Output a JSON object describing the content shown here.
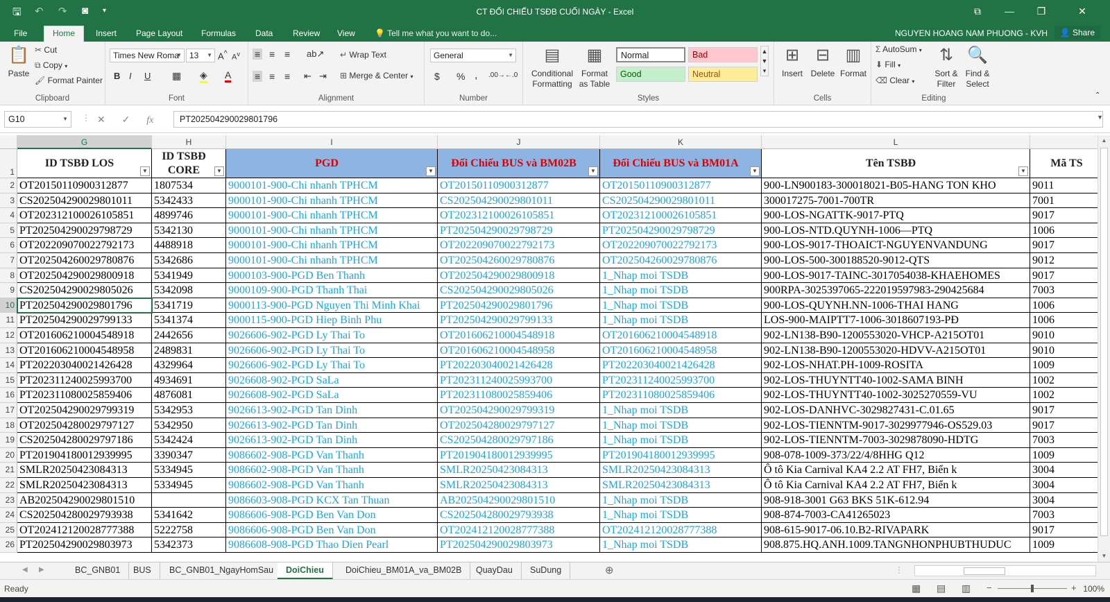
{
  "window": {
    "title": "CT ĐỐI CHIẾU TSĐB CUỐI NGÀY - Excel",
    "minimize_label": "—",
    "maximize_label": "❐",
    "close_label": "✕",
    "ribbon_display_label": "⧉"
  },
  "menu": {
    "file": "File",
    "tabs": [
      "Home",
      "Insert",
      "Page Layout",
      "Formulas",
      "Data",
      "Review",
      "View"
    ],
    "active_tab": "Home",
    "tell_me": "Tell me what you want to do...",
    "user": "NGUYEN HOANG NAM PHUONG - KVH",
    "share": "Share"
  },
  "ribbon": {
    "clipboard": {
      "label": "Clipboard",
      "paste": "Paste",
      "cut": "Cut",
      "copy": "Copy",
      "format_painter": "Format Painter"
    },
    "font": {
      "label": "Font",
      "name": "Times New Roma",
      "size": "13",
      "bold": "B",
      "italic": "I",
      "underline": "U"
    },
    "alignment": {
      "label": "Alignment",
      "wrap_text": "Wrap Text",
      "merge_center": "Merge & Center"
    },
    "number": {
      "label": "Number",
      "format": "General",
      "currency": "$",
      "percent": "%",
      "comma": ","
    },
    "styles": {
      "label": "Styles",
      "conditional": "Conditional Formatting",
      "format_as_table": "Format as Table",
      "normal": "Normal",
      "bad": "Bad",
      "good": "Good",
      "neutral": "Neutral"
    },
    "cells": {
      "label": "Cells",
      "insert": "Insert",
      "delete": "Delete",
      "format": "Format"
    },
    "editing": {
      "label": "Editing",
      "autosum": "AutoSum",
      "fill": "Fill",
      "clear": "Clear",
      "sort_filter": "Sort & Filter",
      "find_select": "Find & Select"
    }
  },
  "formula_bar": {
    "name_box": "G10",
    "fx": "fx",
    "value": "PT202504290029801796"
  },
  "columns": [
    "G",
    "H",
    "I",
    "J",
    "K",
    "L",
    ""
  ],
  "selected_column": "G",
  "selected_row": 10,
  "headers": {
    "G": "ID TSBĐ LOS",
    "H": "ID TSBĐ CORE",
    "I": "PGD",
    "J": "Đối Chiếu BUS và BM02B",
    "K": "Đối Chiếu BUS và BM01A",
    "L": "Tên TSBĐ",
    "M": "Mã TS"
  },
  "rows": [
    {
      "n": "2",
      "g": "OT20150110900312877",
      "h": "1807534",
      "i": "9000101-900-Chi nhanh TPHCM",
      "j": "OT20150110900312877",
      "k": "OT20150110900312877",
      "l": "900-LN900183-300018021-B05-HANG TON KHO",
      "m": "9011"
    },
    {
      "n": "3",
      "g": "CS202504290029801011",
      "h": "5342433",
      "i": "9000101-900-Chi nhanh TPHCM",
      "j": "CS202504290029801011",
      "k": "CS202504290029801011",
      "l": "300017275-7001-700TR",
      "m": "7001"
    },
    {
      "n": "4",
      "g": "OT202312100026105851",
      "h": "4899746",
      "i": "9000101-900-Chi nhanh TPHCM",
      "j": "OT202312100026105851",
      "k": "OT202312100026105851",
      "l": "900-LOS-NGATTK-9017-PTQ",
      "m": "9017"
    },
    {
      "n": "5",
      "g": "PT202504290029798729",
      "h": "5342130",
      "i": "9000101-900-Chi nhanh TPHCM",
      "j": "PT202504290029798729",
      "k": "PT202504290029798729",
      "l": "900-LOS-NTD.QUYNH-1006—PTQ",
      "m": "1006"
    },
    {
      "n": "6",
      "g": "OT202209070022792173",
      "h": "4488918",
      "i": "9000101-900-Chi nhanh TPHCM",
      "j": "OT202209070022792173",
      "k": "OT202209070022792173",
      "l": "900-LOS-9017-THOAICT-NGUYENVANDUNG",
      "m": "9017"
    },
    {
      "n": "7",
      "g": "OT202504260029780876",
      "h": "5342686",
      "i": "9000101-900-Chi nhanh TPHCM",
      "j": "OT202504260029780876",
      "k": "OT202504260029780876",
      "l": "900-LOS-500-300188520-9012-QTS",
      "m": "9012"
    },
    {
      "n": "8",
      "g": "OT202504290029800918",
      "h": "5341949",
      "i": "9000103-900-PGD Ben Thanh",
      "j": "OT202504290029800918",
      "k": "1_Nhap moi TSDB",
      "l": "900-LOS-9017-TAINC-3017054038-KHAEHOMES",
      "m": "9017"
    },
    {
      "n": "9",
      "g": "CS202504290029805026",
      "h": "5342098",
      "i": "9000109-900-PGD Thanh Thai",
      "j": "CS202504290029805026",
      "k": "1_Nhap moi TSDB",
      "l": "900RPA-3025397065-222019597983-290425684",
      "m": "7003"
    },
    {
      "n": "10",
      "g": "PT202504290029801796",
      "h": "5341719",
      "i": "9000113-900-PGD Nguyen Thi Minh Khai",
      "j": "PT202504290029801796",
      "k": "1_Nhap moi TSDB",
      "l": "900-LOS-QUYNH.NN-1006-THAI HANG",
      "m": "1006"
    },
    {
      "n": "11",
      "g": "PT202504290029799133",
      "h": "5341374",
      "i": "9000115-900-PGD Hiep Binh Phu",
      "j": "PT202504290029799133",
      "k": "1_Nhap moi TSDB",
      "l": "LOS-900-MAIPTT7-1006-3018607193-PĐ",
      "m": "1006"
    },
    {
      "n": "12",
      "g": "OT201606210004548918",
      "h": "2442656",
      "i": "9026606-902-PGD Ly Thai To",
      "j": "OT201606210004548918",
      "k": "OT201606210004548918",
      "l": "902-LN138-B90-1200553020-VHCP-A215OT01",
      "m": "9010"
    },
    {
      "n": "13",
      "g": "OT201606210004548958",
      "h": "2489831",
      "i": "9026606-902-PGD Ly Thai To",
      "j": "OT201606210004548958",
      "k": "OT201606210004548958",
      "l": "902-LN138-B90-1200553020-HDVV-A215OT01",
      "m": "9010"
    },
    {
      "n": "14",
      "g": "PT202203040021426428",
      "h": "4329964",
      "i": "9026606-902-PGD Ly Thai To",
      "j": "PT202203040021426428",
      "k": "PT202203040021426428",
      "l": "902-LOS-NHAT.PH-1009-ROSITA",
      "m": "1009"
    },
    {
      "n": "15",
      "g": "PT202311240025993700",
      "h": "4934691",
      "i": "9026608-902-PGD SaLa",
      "j": "PT202311240025993700",
      "k": "PT202311240025993700",
      "l": "902-LOS-THUYNTT40-1002-SAMA BINH",
      "m": "1002"
    },
    {
      "n": "16",
      "g": "PT202311080025859406",
      "h": "4876081",
      "i": "9026608-902-PGD SaLa",
      "j": "PT202311080025859406",
      "k": "PT202311080025859406",
      "l": "902-LOS-THUYNTT40-1002-3025270559-VU",
      "m": "1002"
    },
    {
      "n": "17",
      "g": "OT202504290029799319",
      "h": "5342953",
      "i": "9026613-902-PGD Tan Dinh",
      "j": "OT202504290029799319",
      "k": "1_Nhap moi TSDB",
      "l": "902-LOS-DANHVC-3029827431-C.01.65",
      "m": "9017"
    },
    {
      "n": "18",
      "g": "OT202504280029797127",
      "h": "5342950",
      "i": "9026613-902-PGD Tan Dinh",
      "j": "OT202504280029797127",
      "k": "1_Nhap moi TSDB",
      "l": "902-LOS-TIENNTM-9017-3029977946-OS529.03",
      "m": "9017"
    },
    {
      "n": "19",
      "g": "CS202504280029797186",
      "h": "5342424",
      "i": "9026613-902-PGD Tan Dinh",
      "j": "CS202504280029797186",
      "k": "1_Nhap moi TSDB",
      "l": "902-LOS-TIENNTM-7003-3029878090-HDTG",
      "m": "7003"
    },
    {
      "n": "20",
      "g": "PT201904180012939995",
      "h": "3390347",
      "i": "9086602-908-PGD Van Thanh",
      "j": "PT201904180012939995",
      "k": "PT201904180012939995",
      "l": "908-078-1009-373/22/4/8HHG Q12",
      "m": "1009"
    },
    {
      "n": "21",
      "g": "SMLR20250423084313",
      "h": "5334945",
      "i": "9086602-908-PGD Van Thanh",
      "j": "SMLR20250423084313",
      "k": "SMLR20250423084313",
      "l": "Ô tô Kia Carnival KA4 2.2 AT FH7, Biển k",
      "m": "3004"
    },
    {
      "n": "22",
      "g": "SMLR20250423084313",
      "h": "5334945",
      "i": "9086602-908-PGD Van Thanh",
      "j": "SMLR20250423084313",
      "k": "SMLR20250423084313",
      "l": "Ô tô Kia Carnival KA4 2.2 AT FH7, Biển k",
      "m": "3004"
    },
    {
      "n": "23",
      "g": "AB202504290029801510",
      "h": "",
      "i": "9086603-908-PGD KCX Tan Thuan",
      "j": "AB202504290029801510",
      "k": "1_Nhap moi TSDB",
      "l": "908-918-3001 G63 BKS 51K-612.94",
      "m": "3004"
    },
    {
      "n": "24",
      "g": "CS202504280029793938",
      "h": "5341642",
      "i": "9086606-908-PGD Ben Van Don",
      "j": "CS202504280029793938",
      "k": "1_Nhap moi TSDB",
      "l": "908-874-7003-CA41265023",
      "m": "7003"
    },
    {
      "n": "25",
      "g": "OT202412120028777388",
      "h": "5222758",
      "i": "9086606-908-PGD Ben Van Don",
      "j": "OT202412120028777388",
      "k": "OT202412120028777388",
      "l": "908-615-9017-06.10.B2-RIVAPARK",
      "m": "9017"
    },
    {
      "n": "26",
      "g": "PT202504290029803973",
      "h": "5342373",
      "i": "9086608-908-PGD Thao Dien Pearl",
      "j": "PT202504290029803973",
      "k": "1_Nhap moi TSDB",
      "l": "908.875.HQ.ANH.1009.TANGNHONPHUBTHUDUC",
      "m": "1009"
    }
  ],
  "sheet_tabs": [
    "BC_GNB01",
    "BUS",
    "BC_GNB01_NgayHomSau",
    "DoiChieu",
    "DoiChieu_BM01A_va_BM02B",
    "QuayDau",
    "SuDung"
  ],
  "active_sheet": "DoiChieu",
  "status": {
    "ready": "Ready",
    "zoom": "100%"
  },
  "colors": {
    "accent": "#217346",
    "link_blue": "#1ea6e0",
    "header_highlight": "#8db4e2",
    "header_red": "#e00000"
  }
}
